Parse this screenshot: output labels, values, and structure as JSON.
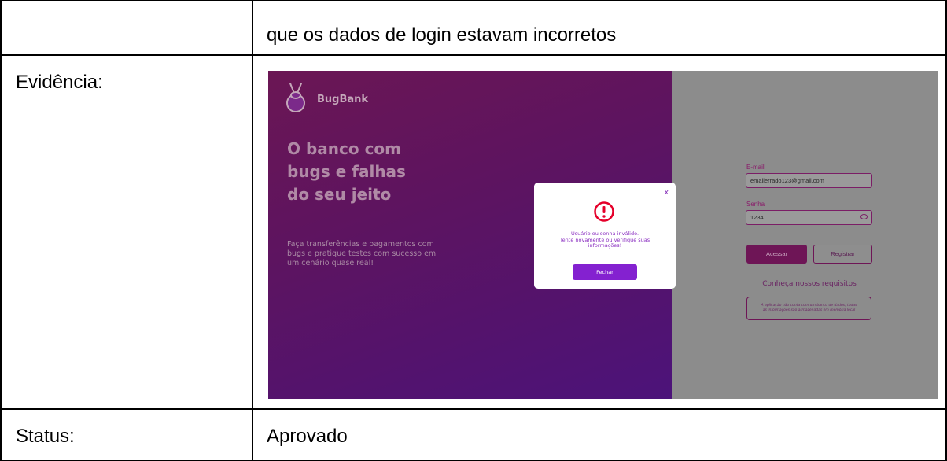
{
  "table": {
    "row1_value": "que os dados de login estavam incorretos",
    "row2_label": "Evidência:",
    "row3_label": "Status:",
    "row3_value": "Aprovado"
  },
  "screenshot": {
    "brand": "BugBank",
    "headline": [
      "O banco com",
      "bugs e falhas",
      "do seu jeito"
    ],
    "subtitle": [
      "Faça transferências e pagamentos com",
      "bugs e pratique testes com sucesso em",
      "um cenário quase real!"
    ],
    "email_label": "E-mail",
    "email_value": "emailerrado123@gmail.com",
    "password_label": "Senha",
    "password_value": "1234",
    "acessar_label": "Acessar",
    "registrar_label": "Registrar",
    "requirements_link": "Conheça nossos requisitos",
    "notice": [
      "A aplicação não conta com um banco de dados, todas",
      "as informações são armazenadas em memória local"
    ],
    "modal": {
      "close_label": "x",
      "message": [
        "Usuário ou senha inválido.",
        "Tente novamente ou verifique suas",
        "informações!"
      ],
      "button_label": "Fechar"
    },
    "colors": {
      "brand_purple": "#8421d0",
      "alert_red": "#e5002a",
      "left_panel": "#5d1460"
    },
    "icons": [
      "bug-logo-icon",
      "eye-icon",
      "alert-circle-icon"
    ]
  }
}
